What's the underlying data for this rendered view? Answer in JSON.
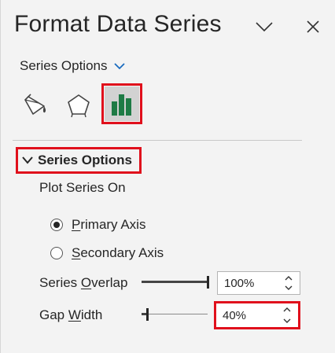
{
  "pane": {
    "title": "Format Data Series",
    "options_dropdown_label": "Series Options",
    "tabs": [
      {
        "name": "Fill & Line",
        "icon": "paint-bucket-icon"
      },
      {
        "name": "Effects",
        "icon": "pentagon-icon"
      },
      {
        "name": "Series Options",
        "icon": "bar-chart-icon",
        "selected": true
      }
    ]
  },
  "section": {
    "title": "Series Options",
    "plot_series_on_label": "Plot Series On",
    "radios": [
      {
        "prefix": "",
        "accel": "P",
        "rest": "rimary Axis",
        "checked": true
      },
      {
        "prefix": "",
        "accel": "S",
        "rest": "econdary Axis",
        "checked": false
      }
    ],
    "overlap": {
      "label_pre": "Series ",
      "label_accel": "O",
      "label_post": "verlap",
      "value": "100%",
      "percent": 100
    },
    "gap": {
      "label_pre": "Gap ",
      "label_accel": "W",
      "label_post": "idth",
      "value": "40%",
      "percent": 40
    }
  },
  "colors": {
    "highlight": "#e0101c",
    "accent": "#1a6bbf",
    "chart_green": "#1e7b45"
  }
}
